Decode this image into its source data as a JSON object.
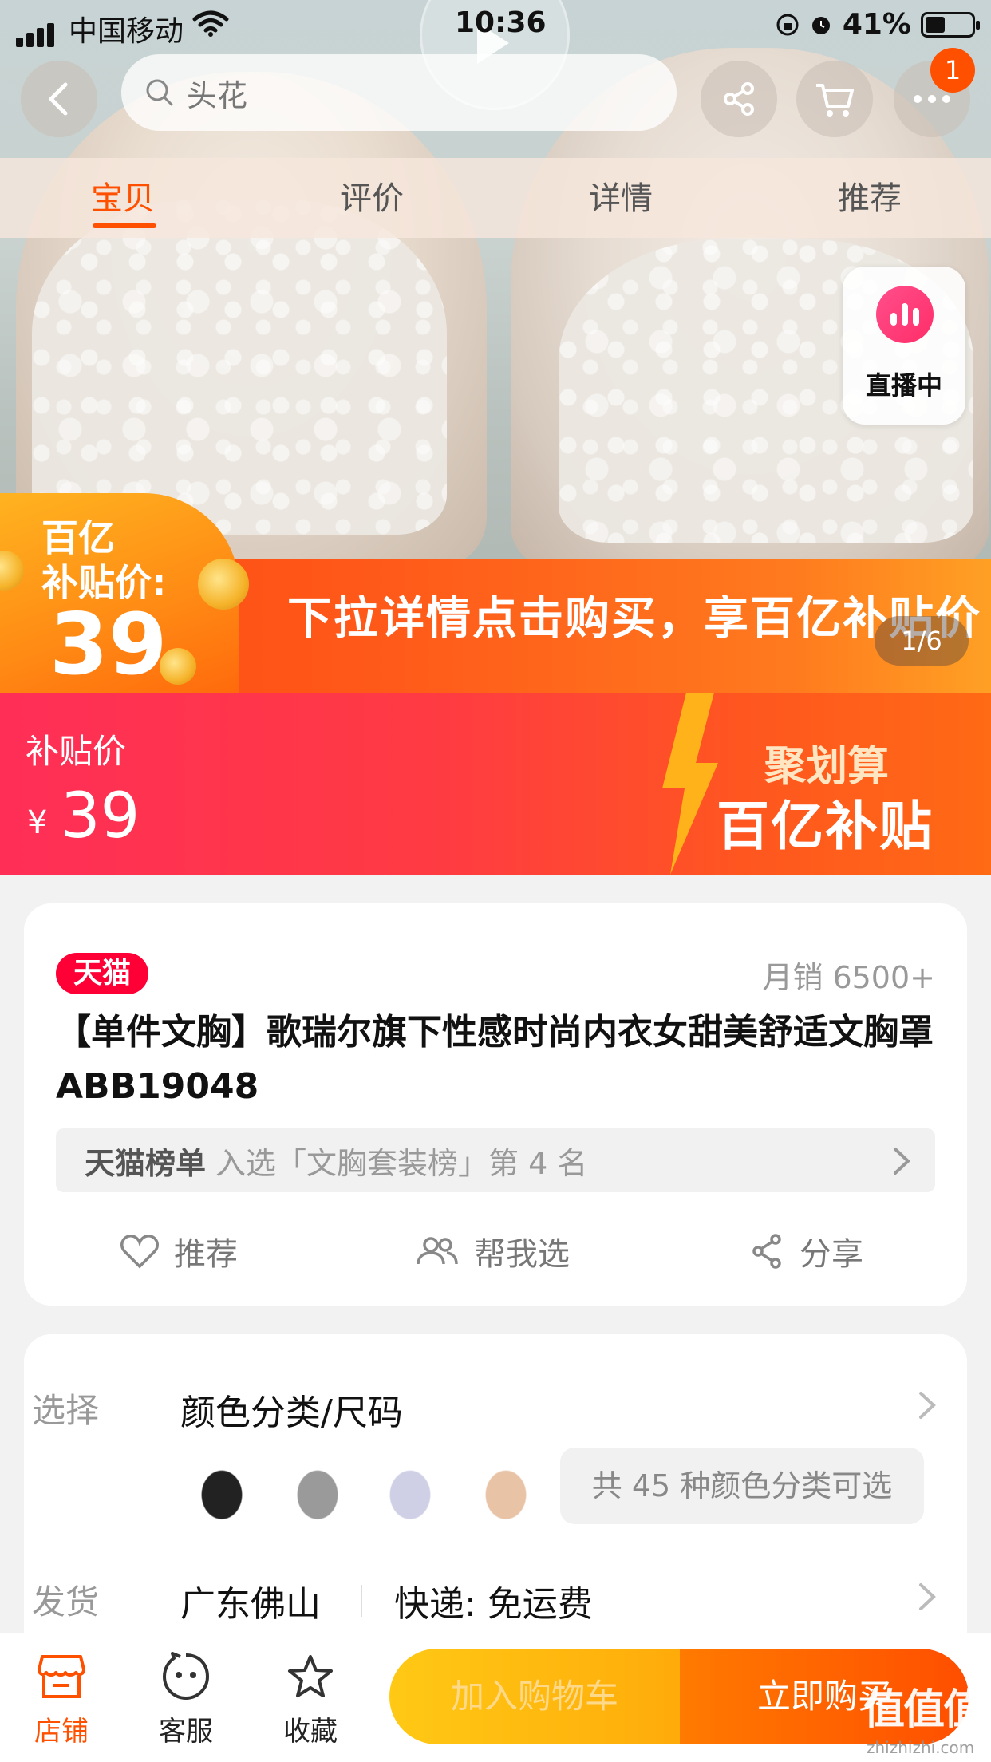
{
  "status_bar": {
    "carrier": "中国移动",
    "time": "10:36",
    "battery": "41%"
  },
  "nav": {
    "search_placeholder": "头花",
    "cart_badge": "1"
  },
  "tabs": [
    {
      "label": "宝贝",
      "active": true
    },
    {
      "label": "评价"
    },
    {
      "label": "详情"
    },
    {
      "label": "推荐"
    }
  ],
  "live": {
    "label": "直播中"
  },
  "hero": {
    "subsidy_line1": "百亿",
    "subsidy_line2": "补贴价:",
    "subsidy_price": "39",
    "banner_text": "下拉详情点击购买，享百亿补贴价",
    "page_indicator": "1/6"
  },
  "price_banner": {
    "label": "补贴价",
    "currency": "¥",
    "price": "39",
    "promo_top": "聚划算",
    "promo_bottom": "百亿补贴"
  },
  "product": {
    "store_tag": "天猫",
    "monthly_sales": "月销 6500+",
    "title": "【单件文胸】歌瑞尔旗下性感时尚内衣女甜美舒适文胸罩ABB19048",
    "rank_brand": "天猫榜单",
    "rank_text": "入选「文胸套装榜」第 4 名",
    "actions": {
      "recommend": "推荐",
      "help_choose": "帮我选",
      "share": "分享"
    }
  },
  "options": {
    "select_label": "选择",
    "select_value": "颜色分类/尺码",
    "colors_text": "共 45 种颜色分类可选",
    "ship_label": "发货",
    "ship_from": "广东佛山",
    "ship_method": "快递: 免运费"
  },
  "bottom_bar": {
    "shop": "店铺",
    "service": "客服",
    "favorite": "收藏",
    "add_to_cart": "加入购物车",
    "buy_now": "立即购买"
  },
  "watermark": {
    "text": "值值值",
    "sub": "zhizhizhi.com"
  },
  "colors": {
    "accent": "#ff5000",
    "tmall_red": "#ff0036",
    "promo_gradient_start": "#ff2e57",
    "promo_gradient_end": "#ff6a14"
  }
}
